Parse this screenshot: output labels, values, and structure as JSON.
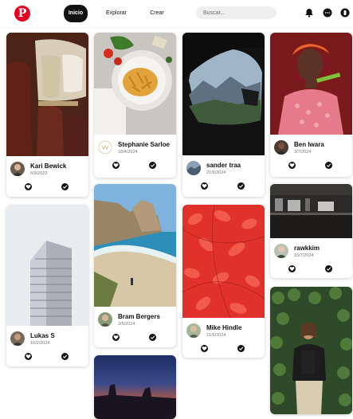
{
  "app": {
    "logo_letter": "P",
    "brand_color": "#e60023"
  },
  "nav": [
    {
      "label": "Inicio",
      "active": true
    },
    {
      "label": "Explorar",
      "active": false
    },
    {
      "label": "Crear",
      "active": false
    }
  ],
  "search": {
    "placeholder": "Buscar..."
  },
  "header_icons": [
    "bell-icon",
    "chat-icon",
    "profile-icon"
  ],
  "pins": [
    {
      "author": "Kari Bewick",
      "date": "6/9/2022",
      "image": "train-window-seats"
    },
    {
      "author": "Lukas S",
      "date": "16/2/2024",
      "image": "white-skyscraper"
    },
    {
      "author": "Stephanie Sarloe",
      "date": "18/4/2024",
      "image": "pasta-plate"
    },
    {
      "author": "Bram Bergers",
      "date": "2/6/2024",
      "image": "rocky-beach"
    },
    {
      "author": "",
      "date": "",
      "image": "desert-sunset"
    },
    {
      "author": "sander traa",
      "date": "21/6/2024",
      "image": "car-window-mountains"
    },
    {
      "author": "Mike Hindle",
      "date": "21/6/2024",
      "image": "red-leaves"
    },
    {
      "author": "Ben Iwara",
      "date": "3/7/2024",
      "image": "woman-pink-outfit"
    },
    {
      "author": "rawkkim",
      "date": "15/7/2024",
      "image": "cafe-counter"
    },
    {
      "author": "",
      "date": "",
      "image": "woman-ivy-wall"
    }
  ]
}
